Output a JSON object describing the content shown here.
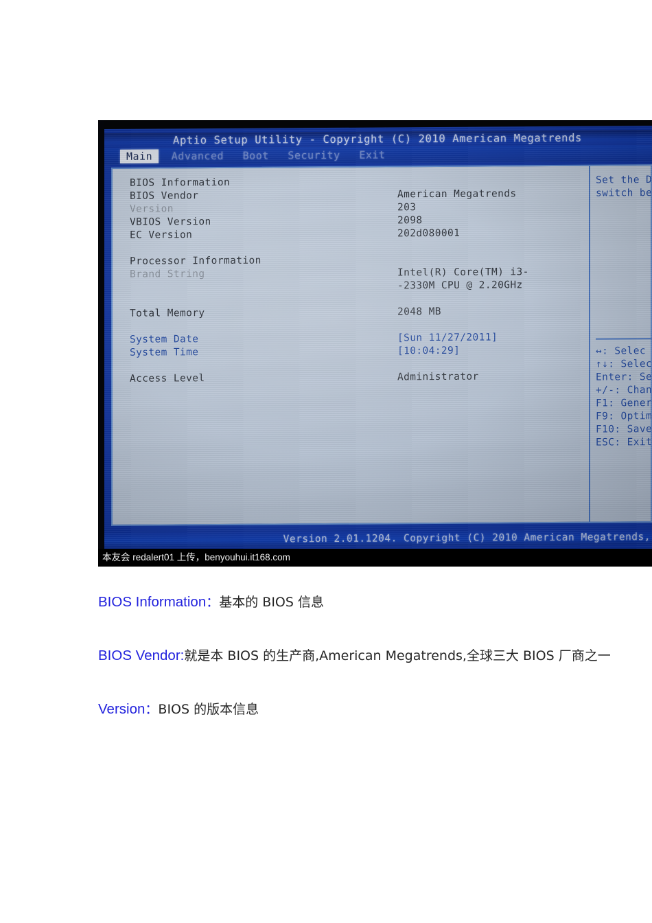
{
  "bios": {
    "title": "Aptio Setup Utility - Copyright (C) 2010 American Megatrends",
    "tabs": [
      {
        "label": "Main",
        "active": true
      },
      {
        "label": "Advanced",
        "active": false
      },
      {
        "label": "Boot",
        "active": false
      },
      {
        "label": "Security",
        "active": false
      },
      {
        "label": "Exit",
        "active": false
      }
    ],
    "settings": [
      {
        "label": "BIOS Information",
        "value": "",
        "style": "normal"
      },
      {
        "label": "BIOS Vendor",
        "value": "American Megatrends",
        "style": "normal"
      },
      {
        "label": "Version",
        "value": "203",
        "style": "dim"
      },
      {
        "label": "VBIOS Version",
        "value": "2098",
        "style": "normal"
      },
      {
        "label": "EC Version",
        "value": "202d080001",
        "style": "normal"
      },
      {
        "label": "",
        "value": "",
        "style": "spacer"
      },
      {
        "label": "Processor Information",
        "value": "",
        "style": "normal"
      },
      {
        "label": "Brand String",
        "value": "Intel(R) Core(TM) i3-",
        "style": "dim"
      },
      {
        "label": "",
        "value": "-2330M CPU @ 2.20GHz",
        "style": "normal"
      },
      {
        "label": "",
        "value": "",
        "style": "spacer"
      },
      {
        "label": "Total Memory",
        "value": "2048 MB",
        "style": "normal"
      },
      {
        "label": "",
        "value": "",
        "style": "spacer"
      },
      {
        "label": "System Date",
        "value": "[Sun 11/27/2011]",
        "style": "highlight"
      },
      {
        "label": "System Time",
        "value": "[10:04:29]",
        "style": "highlight"
      },
      {
        "label": "",
        "value": "",
        "style": "spacer"
      },
      {
        "label": "Access Level",
        "value": "Administrator",
        "style": "normal"
      }
    ],
    "help_lines": [
      "Set the D",
      "switch be"
    ],
    "key_legend": [
      "↔: Selec",
      "↑↓: Selec",
      "Enter: Se",
      "+/-: Chan",
      "F1: Gener",
      "F9: Optim",
      "F10: Save",
      "ESC: Exit"
    ],
    "footer": "Version 2.01.1204. Copyright (C) 2010 American Megatrends,",
    "watermark": "本友会 redalert01 上传，benyouhui.it168.com"
  },
  "article": {
    "paragraphs": [
      {
        "heading": "BIOS Information",
        "separator": "：",
        "body": "基本的 BIOS 信息"
      },
      {
        "heading": "BIOS Vendor",
        "separator": ":",
        "body": "就是本 BIOS 的生产商,American Megatrends,全球三大 BIOS 厂商之一"
      },
      {
        "heading": "Version",
        "separator": "：",
        "body": "BIOS 的版本信息"
      }
    ]
  }
}
